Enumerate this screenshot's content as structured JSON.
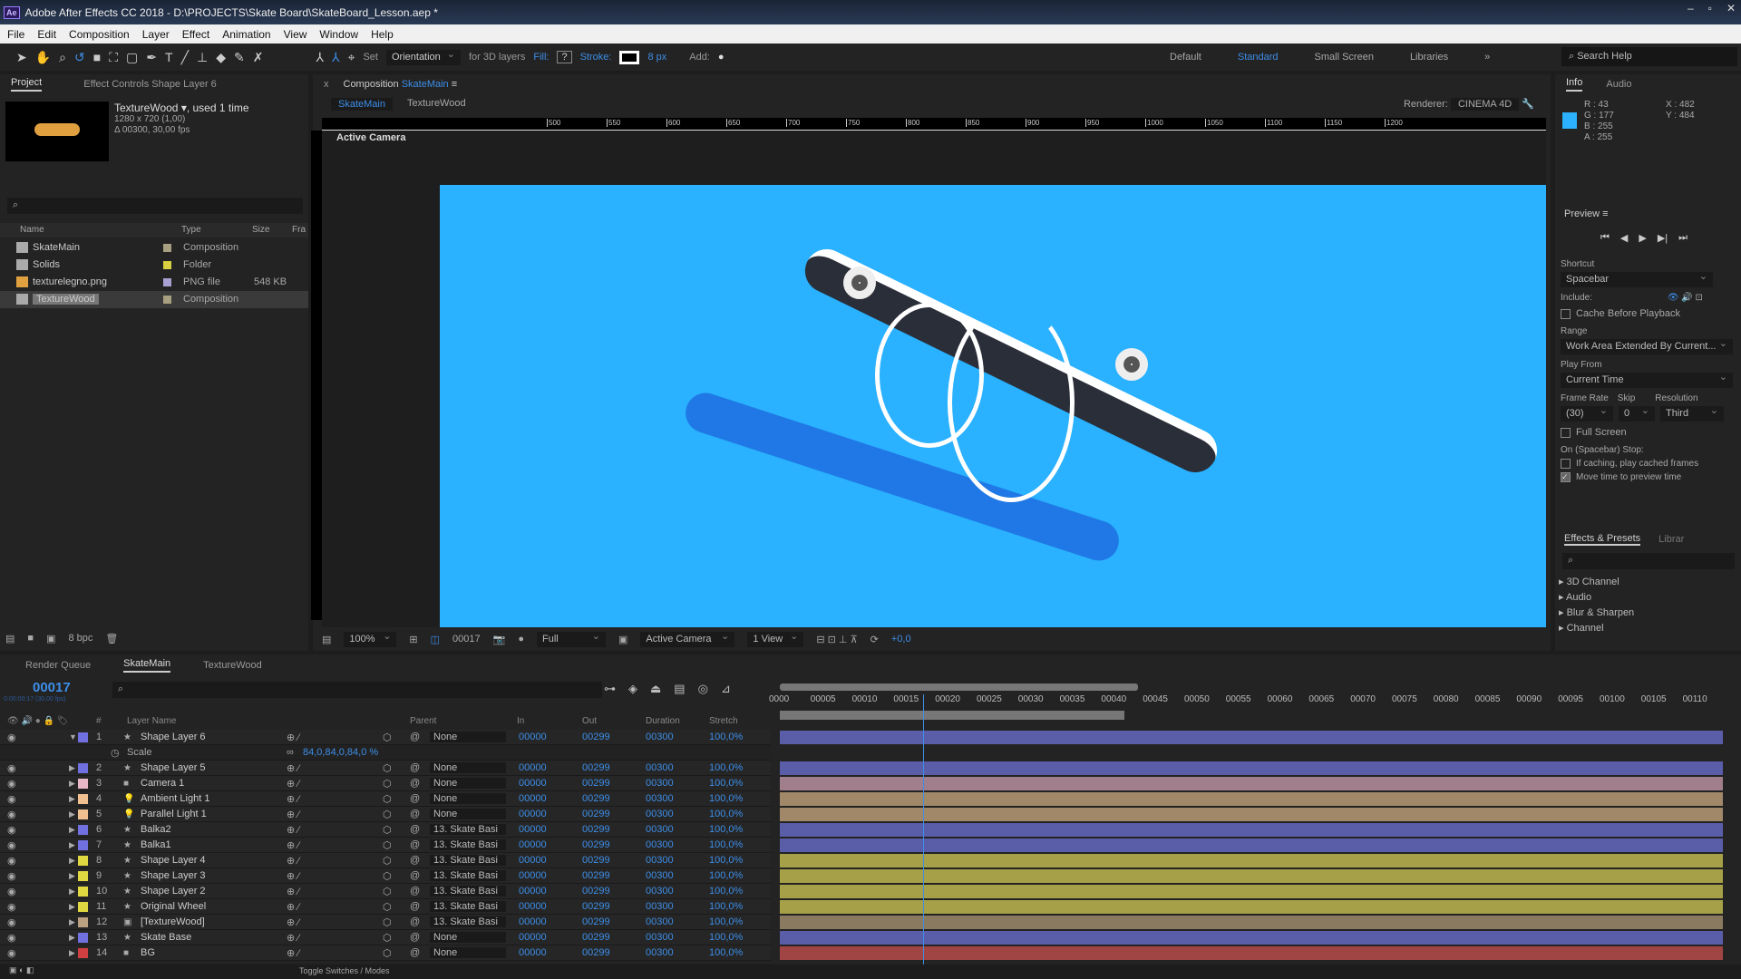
{
  "window": {
    "title": "Adobe After Effects CC 2018 - D:\\PROJECTS\\Skate Board\\SkateBoard_Lesson.aep *",
    "app_badge": "Ae"
  },
  "menu": [
    "File",
    "Edit",
    "Composition",
    "Layer",
    "Effect",
    "Animation",
    "View",
    "Window",
    "Help"
  ],
  "toolbar": {
    "set": "Set",
    "orientation": "Orientation",
    "for3d": "for 3D layers",
    "fill": "Fill:",
    "fill_value": "?",
    "stroke": "Stroke:",
    "stroke_px": "8 px",
    "add": "Add:"
  },
  "workspaces": {
    "items": [
      "Default",
      "Standard",
      "Small Screen",
      "Libraries"
    ],
    "active": "Standard",
    "search": "Search Help"
  },
  "project": {
    "tab": "Project",
    "effect_tab": "Effect Controls Shape Layer 6",
    "selected_name": "TextureWood",
    "used": ", used 1 time",
    "dims": "1280 x 720 (1,00)",
    "duration": "Δ 00300, 30,00 fps",
    "columns": [
      "Name",
      "Type",
      "Size",
      "Fra"
    ],
    "items": [
      {
        "name": "SkateMain",
        "type": "Composition",
        "size": "",
        "label": "#a89f80"
      },
      {
        "name": "Solids",
        "type": "Folder",
        "size": "",
        "label": "#d8d040"
      },
      {
        "name": "texturelegno.png",
        "type": "PNG file",
        "size": "548 KB",
        "label": "#a8a0d0"
      },
      {
        "name": "TextureWood",
        "type": "Composition",
        "size": "",
        "label": "#a89f80"
      }
    ],
    "bpc": "8 bpc"
  },
  "comp": {
    "tab_prefix": "Composition",
    "tab_name": "SkateMain",
    "breadcrumbs": [
      "SkateMain",
      "TextureWood"
    ],
    "renderer_label": "Renderer:",
    "renderer": "CINEMA 4D",
    "view_label": "Active Camera",
    "ruler": [
      "500",
      "550",
      "600",
      "650",
      "700",
      "750",
      "800",
      "850",
      "900",
      "950",
      "1000",
      "1050",
      "1100",
      "1150",
      "1200"
    ],
    "bg_color": "#2ab1ff",
    "footer": {
      "zoom": "100%",
      "frame": "00017",
      "resolution": "Full",
      "camera": "Active Camera",
      "views": "1 View",
      "exposure": "+0,0"
    }
  },
  "info": {
    "tab": "Info",
    "audio_tab": "Audio",
    "r": "R : 43",
    "g": "G : 177",
    "b": "B : 255",
    "a": "A : 255",
    "x": "X : 482",
    "y": "Y : 484",
    "swatch": "#2bb1ff"
  },
  "preview": {
    "title": "Preview",
    "shortcut_label": "Shortcut",
    "shortcut": "Spacebar",
    "include": "Include:",
    "cache": "Cache Before Playback",
    "range_label": "Range",
    "range": "Work Area Extended By Current...",
    "playfrom_label": "Play From",
    "playfrom": "Current Time",
    "fr_label": "Frame Rate",
    "skip_label": "Skip",
    "res_label": "Resolution",
    "fr": "(30)",
    "skip": "0",
    "res": "Third",
    "fullscreen": "Full Screen",
    "stop_label": "On (Spacebar) Stop:",
    "if_caching": "If caching, play cached frames",
    "move_time": "Move time to preview time",
    "move_time_checked": true
  },
  "effects": {
    "tab": "Effects & Presets",
    "lib_tab": "Librar",
    "items": [
      "3D Channel",
      "Audio",
      "Blur & Sharpen",
      "Channel"
    ]
  },
  "timeline": {
    "tabs": [
      "Render Queue",
      "SkateMain",
      "TextureWood"
    ],
    "timecode": "00017",
    "timecode_sub": "0:00:00:17 (30.00 fps)",
    "columns": [
      "#",
      "Layer Name",
      "Parent",
      "In",
      "Out",
      "Duration",
      "Stretch"
    ],
    "ticks": [
      "0000",
      "00005",
      "00010",
      "00015",
      "00020",
      "00025",
      "00030",
      "00035",
      "00040",
      "00045",
      "00050",
      "00055",
      "00060",
      "00065",
      "00070",
      "00075",
      "00080",
      "00085",
      "00090",
      "00095",
      "00100",
      "00105",
      "00110"
    ],
    "current_frame": 17,
    "scale_prop": {
      "label": "Scale",
      "value": "84,0,84,0,84,0 %"
    },
    "layers": [
      {
        "n": "1",
        "name": "Shape Layer 6",
        "icon": "★",
        "label": "#7070e0",
        "parent": "None",
        "bar": "#5a5ea8"
      },
      {
        "n": "2",
        "name": "Shape Layer 5",
        "icon": "★",
        "label": "#7070e0",
        "parent": "None",
        "bar": "#5a5ea8"
      },
      {
        "n": "3",
        "name": "Camera 1",
        "icon": "■",
        "label": "#e8b8c8",
        "parent": "None",
        "bar": "#a07e8c"
      },
      {
        "n": "4",
        "name": "Ambient Light 1",
        "icon": "💡",
        "label": "#f0c090",
        "parent": "None",
        "bar": "#a08868"
      },
      {
        "n": "5",
        "name": "Parallel Light 1",
        "icon": "💡",
        "label": "#f0c090",
        "parent": "None",
        "bar": "#a08868"
      },
      {
        "n": "6",
        "name": "Balka2",
        "icon": "★",
        "label": "#7070e0",
        "parent": "13. Skate Basi",
        "bar": "#5a5ea8"
      },
      {
        "n": "7",
        "name": "Balka1",
        "icon": "★",
        "label": "#7070e0",
        "parent": "13. Skate Basi",
        "bar": "#5a5ea8"
      },
      {
        "n": "8",
        "name": "Shape Layer 4",
        "icon": "★",
        "label": "#e0d840",
        "parent": "13. Skate Basi",
        "bar": "#a6a048"
      },
      {
        "n": "9",
        "name": "Shape Layer 3",
        "icon": "★",
        "label": "#e0d840",
        "parent": "13. Skate Basi",
        "bar": "#a6a048"
      },
      {
        "n": "10",
        "name": "Shape Layer 2",
        "icon": "★",
        "label": "#e0d840",
        "parent": "13. Skate Basi",
        "bar": "#a6a048"
      },
      {
        "n": "11",
        "name": "Original Wheel",
        "icon": "★",
        "label": "#e0d840",
        "parent": "13. Skate Basi",
        "bar": "#a6a048"
      },
      {
        "n": "12",
        "name": "[TextureWood]",
        "icon": "▣",
        "label": "#b8a080",
        "parent": "13. Skate Basi",
        "bar": "#8a7a60"
      },
      {
        "n": "13",
        "name": "Skate Base",
        "icon": "★",
        "label": "#7070e0",
        "parent": "None",
        "bar": "#5a5ea8"
      },
      {
        "n": "14",
        "name": "BG",
        "icon": "■",
        "label": "#d04040",
        "parent": "None",
        "bar": "#a04444"
      }
    ],
    "in": "00000",
    "out": "00299",
    "duration": "00300",
    "stretch": "100,0%",
    "toggle": "Toggle Switches / Modes"
  }
}
